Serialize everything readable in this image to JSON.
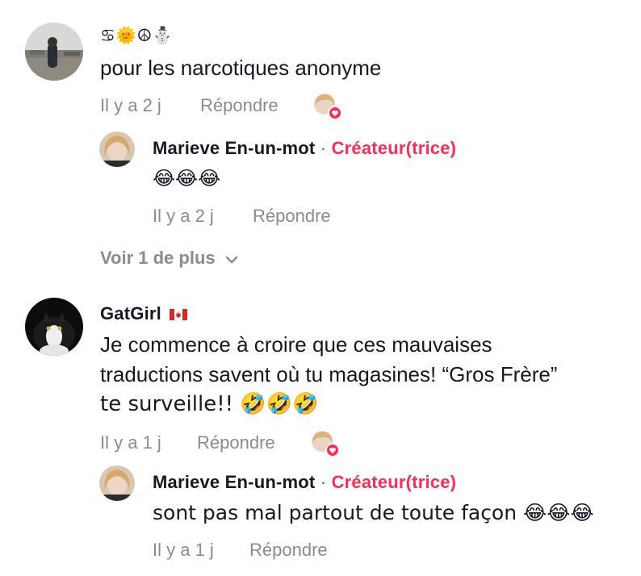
{
  "comments": [
    {
      "username_emojis": "♋🌞☮⛄",
      "text": "pour les narcotiques anonyme",
      "time": "Il y a 2 j",
      "reply_label": "Répondre",
      "replies": [
        {
          "username": "Marieve En-un-mot",
          "separator": "·",
          "badge": "Créateur(trice)",
          "text": "😂😂😂",
          "time": "Il y a 2 j",
          "reply_label": "Répondre"
        }
      ],
      "more_label": "Voir 1 de plus"
    },
    {
      "username": "GatGirl",
      "flag": "🇨🇦",
      "text_lines": [
        "Je commence à croire que ces mauvaises",
        "traductions savent où tu magasines! “Gros Frère”",
        "te surveille!! 🤣🤣🤣"
      ],
      "time": "Il y a 1 j",
      "reply_label": "Répondre",
      "replies": [
        {
          "username": "Marieve En-un-mot",
          "separator": "·",
          "badge": "Créateur(trice)",
          "text": "sont pas mal partout de toute façon 😂😂😂",
          "time": "Il y a 1 j",
          "reply_label": "Répondre"
        }
      ]
    }
  ],
  "colors": {
    "creator_badge": "#fe2c55",
    "meta": "#8a8b91",
    "text": "#161823",
    "heart": "#fe2c55"
  }
}
